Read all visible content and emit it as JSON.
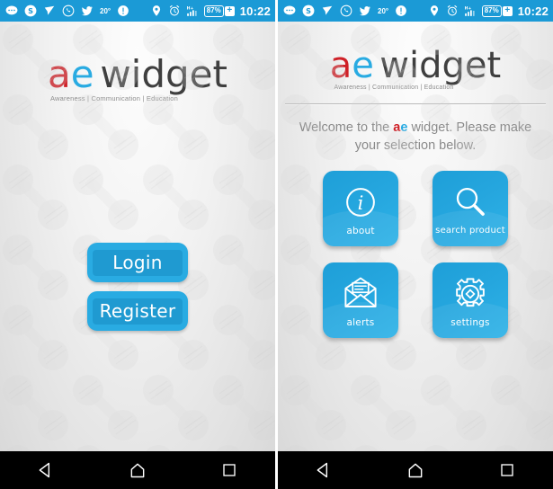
{
  "status_bar": {
    "icons": [
      "messages-icon",
      "skype-icon",
      "paper-plane-icon",
      "whatsapp-icon",
      "twitter-icon"
    ],
    "temperature": "20°",
    "right_icons": [
      "cloud-alert-icon",
      "location-pin-icon",
      "alarm-clock-icon",
      "signal-hspa-icon"
    ],
    "battery_percent": "87%",
    "battery_charging_symbol": "+",
    "time": "10:22",
    "background_color": "#1b9ad6"
  },
  "brand": {
    "letter_a": "a",
    "letter_e": "e",
    "word": "widget",
    "tagline": "Awareness | Communication | Education",
    "color_a": "#cf2027",
    "color_e": "#29abe2",
    "color_word": "#3f3f3f"
  },
  "screen_login": {
    "buttons": [
      {
        "label": "Login",
        "name": "login-button"
      },
      {
        "label": "Register",
        "name": "register-button"
      }
    ]
  },
  "screen_menu": {
    "welcome_prefix": "Welcome to the ",
    "welcome_suffix": " widget. Please make your selection below.",
    "tiles": [
      {
        "label": "about",
        "icon": "info-circle-icon"
      },
      {
        "label": "search product",
        "icon": "magnifier-icon"
      },
      {
        "label": "alerts",
        "icon": "open-envelope-icon"
      },
      {
        "label": "settings",
        "icon": "gear-icon"
      }
    ],
    "tile_color": "#25a6de"
  },
  "nav_bar": {
    "buttons": [
      {
        "label": "Back",
        "icon": "back-triangle-icon"
      },
      {
        "label": "Home",
        "icon": "home-icon"
      },
      {
        "label": "Recents",
        "icon": "recents-square-icon"
      }
    ],
    "background_color": "#000000"
  }
}
